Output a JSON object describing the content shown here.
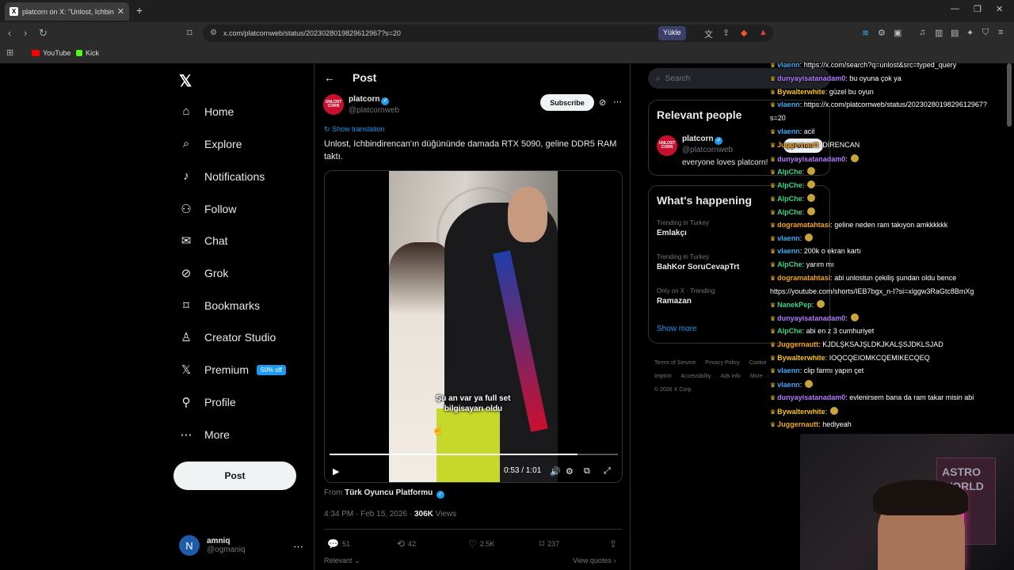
{
  "browser": {
    "tab_title": "platcorn on X: \"Unlost, Ichbin",
    "tab_favicon": "X",
    "url": "x.com/platcornweb/status/2023028019829612967?s=20",
    "yukle_label": "Yükle",
    "bookmarks": [
      {
        "label": "YouTube",
        "color": "#ff0000"
      },
      {
        "label": "Kick",
        "color": "#53fc18"
      }
    ]
  },
  "leftnav": {
    "logo": "𝕏",
    "items": [
      {
        "label": "Home",
        "icon": "home-icon",
        "glyph": "⌂"
      },
      {
        "label": "Explore",
        "icon": "search-icon",
        "glyph": "⌕"
      },
      {
        "label": "Notifications",
        "icon": "bell-icon",
        "glyph": "♪"
      },
      {
        "label": "Follow",
        "icon": "person-plus-icon",
        "glyph": "⚇"
      },
      {
        "label": "Chat",
        "icon": "mail-icon",
        "glyph": "✉"
      },
      {
        "label": "Grok",
        "icon": "grok-icon",
        "glyph": "⊘"
      },
      {
        "label": "Bookmarks",
        "icon": "bookmark-icon",
        "glyph": "⌑"
      },
      {
        "label": "Creator Studio",
        "icon": "creator-studio-icon",
        "glyph": "♙"
      },
      {
        "label": "Premium",
        "icon": "x-premium-icon",
        "glyph": "𝕏"
      },
      {
        "label": "Profile",
        "icon": "profile-icon",
        "glyph": "⚲"
      },
      {
        "label": "More",
        "icon": "more-circle-icon",
        "glyph": "⋯"
      }
    ],
    "premium_badge": "50% off",
    "post_button": "Post",
    "account": {
      "initial": "N",
      "name": "amniq",
      "handle": "@ogmaniq"
    }
  },
  "post": {
    "header_title": "Post",
    "author_name": "platcorn",
    "author_handle": "@platcornweb",
    "avatar_text": "UNLOST CORN",
    "subscribe_label": "Subscribe",
    "show_translation": "Show translation",
    "text": "Unlost, Ichbindirencan'ın düğününde damada RTX 5090, geline DDR5 RAM taktı.",
    "video": {
      "caption": "Şu an var ya full set bilgisayarı oldu",
      "time": "0:53 / 1:01",
      "progress": 0.86
    },
    "from_label": "From",
    "from_source": "Türk Oyuncu Platformu",
    "timestamp": "4:34 PM · Feb 15, 2026 · ",
    "views_count": "306K",
    "views_label": " Views",
    "actions": {
      "replies": "51",
      "reposts": "42",
      "likes": "2.5K",
      "bookmarks": "237"
    },
    "relevant_label": "Relevant ⌄",
    "view_quotes": "View quotes ›"
  },
  "sidebar": {
    "search_placeholder": "Search",
    "relevant_people_title": "Relevant people",
    "person": {
      "name": "platcorn",
      "handle": "@platcornweb",
      "bio": "everyone loves platcorn!",
      "follow_label": "Follow"
    },
    "happening_title": "What's happening",
    "trends": [
      {
        "context": "Trending in Turkey",
        "topic": "Emlakçı"
      },
      {
        "context": "Trending in Turkey",
        "topic": "BahKor SoruCevapTrt"
      },
      {
        "context": "Only on X · Trending",
        "topic": "Ramazan"
      }
    ],
    "show_more": "Show more",
    "footer": [
      "Terms of Service",
      "Privacy Policy",
      "Cookie",
      "Imprint",
      "Accessibility",
      "Ads info",
      "More ···",
      "© 2026 X Corp."
    ]
  },
  "chat": [
    {
      "user": "vlaenn",
      "color": "#3fa9f5",
      "text": ": https://x.com/search?q=unlost&src=typed_query"
    },
    {
      "user": "dunyayisatanadam0",
      "color": "#b47cff",
      "text": ": bu oyuna çok ya"
    },
    {
      "user": "Bywalterwhite",
      "color": "#f5c518",
      "text": ": güzel bu oyun"
    },
    {
      "user": "vlaenn",
      "color": "#3fa9f5",
      "text": ": https://x.com/platcornweb/status/2023028019829612967?"
    },
    {
      "user": "",
      "color": "#ffffff",
      "text": "s=20"
    },
    {
      "user": "vlaenn",
      "color": "#3fa9f5",
      "text": ": acil"
    },
    {
      "user": "Juggernautt",
      "color": "#f5a623",
      "text": ": DİRENCAN"
    },
    {
      "user": "dunyayisatanadam0",
      "color": "#b47cff",
      "text": ":"
    },
    {
      "user": "AlpChe",
      "color": "#3fd38a",
      "text": ":"
    },
    {
      "user": "AlpChe",
      "color": "#3fd38a",
      "text": ":"
    },
    {
      "user": "AlpChe",
      "color": "#3fd38a",
      "text": ":"
    },
    {
      "user": "AlpChe",
      "color": "#3fd38a",
      "text": ":"
    },
    {
      "user": "dogramatahtasi",
      "color": "#f5a623",
      "text": ": geline neden ram takıyon amkkkkkk"
    },
    {
      "user": "vlaenn",
      "color": "#3fa9f5",
      "text": ":"
    },
    {
      "user": "vlaenn",
      "color": "#3fa9f5",
      "text": ": 200k o ekran kartı"
    },
    {
      "user": "AlpChe",
      "color": "#3fd38a",
      "text": ": yarım mı"
    },
    {
      "user": "dogramatahtasi",
      "color": "#f5a623",
      "text": ": abi unlostun çekiliş şundan oldu bence"
    },
    {
      "user": "",
      "color": "#ffffff",
      "text": "https://youtube.com/shorts/IEB7bgx_n-I?si=xlggw3RaGtc8BmXg"
    },
    {
      "user": "NanekPep",
      "color": "#3fd38a",
      "text": ":"
    },
    {
      "user": "dunyayisatanadam0",
      "color": "#b47cff",
      "text": ":"
    },
    {
      "user": "AlpChe",
      "color": "#3fd38a",
      "text": ": abi en z 3 cumhuriyet"
    },
    {
      "user": "Juggernautt",
      "color": "#f5a623",
      "text": ": KJDLŞKSAJŞLDKJKALŞSJDKLSJAD"
    },
    {
      "user": "Bywalterwhite",
      "color": "#f5c518",
      "text": ": IOQCQEIOMKCQEMIKECQEQ"
    },
    {
      "user": "vlaenn",
      "color": "#3fa9f5",
      "text": ": clip farmı yapın çet"
    },
    {
      "user": "vlaenn",
      "color": "#3fa9f5",
      "text": ":"
    },
    {
      "user": "dunyayisatanadam0",
      "color": "#b47cff",
      "text": ": evlenirsem bana da ram takar misin abi"
    },
    {
      "user": "Bywalterwhite",
      "color": "#f5c518",
      "text": ":"
    },
    {
      "user": "Juggernautt",
      "color": "#f5a623",
      "text": ": hediyeah"
    }
  ],
  "webcam": {
    "poster_text": "ASTRO WORLD"
  }
}
